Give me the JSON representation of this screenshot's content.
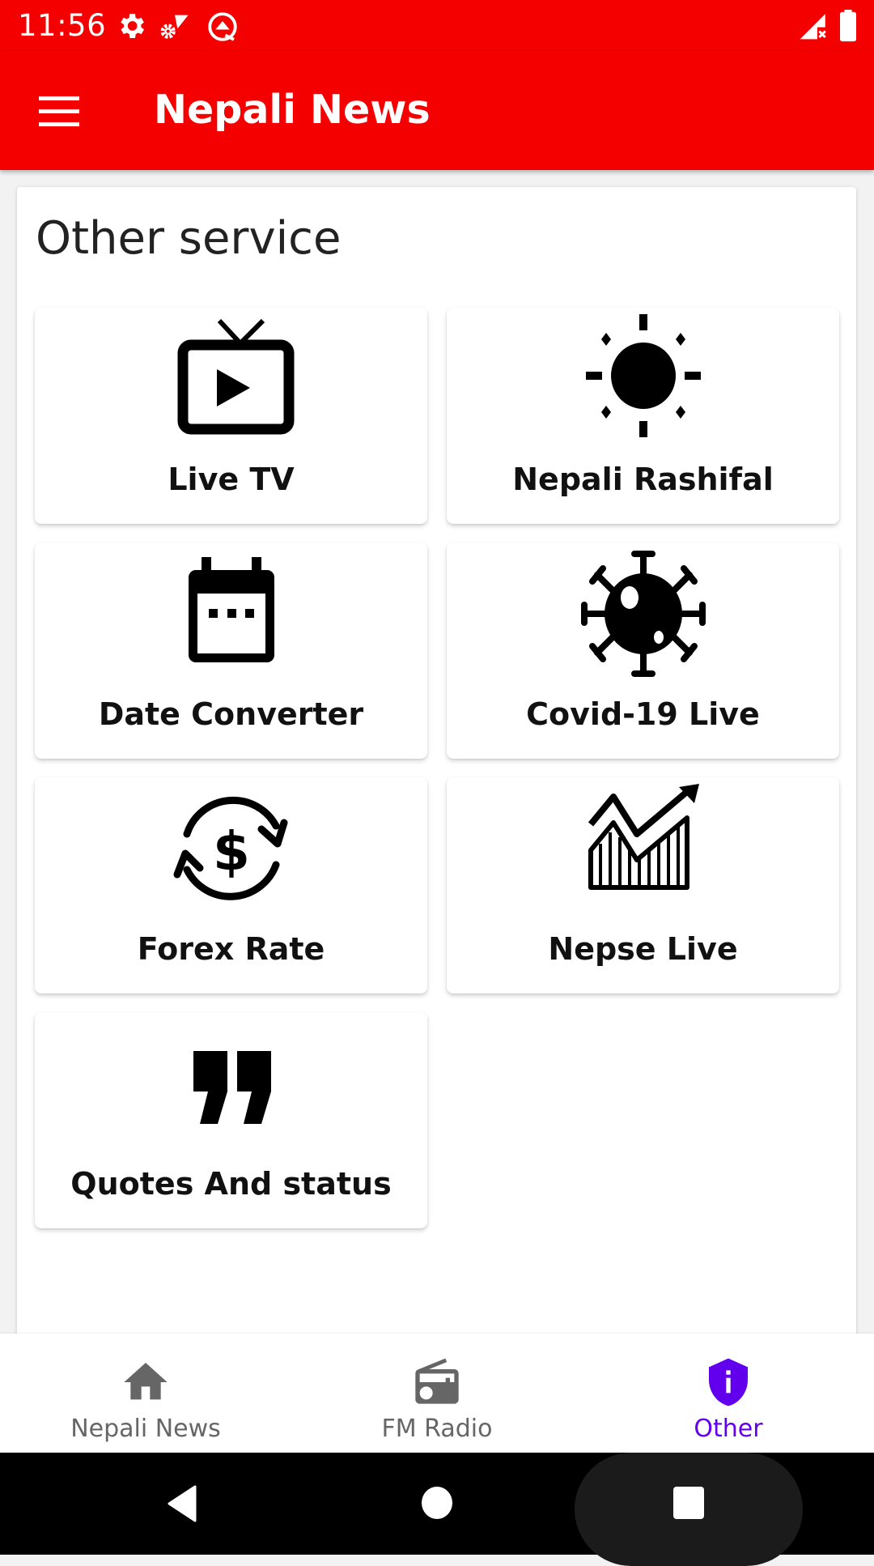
{
  "status_bar": {
    "time": "11:56",
    "icons": [
      "settings-gear-icon",
      "network-settings-icon",
      "android-q-icon",
      "signal-no-service-icon",
      "battery-full-icon"
    ]
  },
  "toolbar": {
    "menu_icon": "hamburger-menu-icon",
    "title": "Nepali News"
  },
  "main": {
    "section_title": "Other service",
    "tiles": [
      {
        "label": "Live TV",
        "icon": "live-tv-icon"
      },
      {
        "label": "Nepali Rashifal",
        "icon": "sun-icon"
      },
      {
        "label": "Date Converter",
        "icon": "calendar-icon"
      },
      {
        "label": "Covid-19 Live",
        "icon": "virus-icon"
      },
      {
        "label": "Forex Rate",
        "icon": "currency-exchange-icon"
      },
      {
        "label": "Nepse Live",
        "icon": "stock-chart-icon"
      },
      {
        "label": "Quotes And status",
        "icon": "quote-icon"
      }
    ]
  },
  "bottom_nav": {
    "active_color": "#6200ee",
    "inactive_color": "#666666",
    "items": [
      {
        "label": "Nepali News",
        "icon": "home-icon",
        "active": false
      },
      {
        "label": "FM Radio",
        "icon": "radio-icon",
        "active": false
      },
      {
        "label": "Other",
        "icon": "shield-info-icon",
        "active": true
      }
    ]
  },
  "system_nav": {
    "buttons": [
      "back-icon",
      "home-circle-icon",
      "recents-icon"
    ]
  },
  "colors": {
    "brand_red": "#f40000",
    "accent_purple": "#6200ee"
  }
}
